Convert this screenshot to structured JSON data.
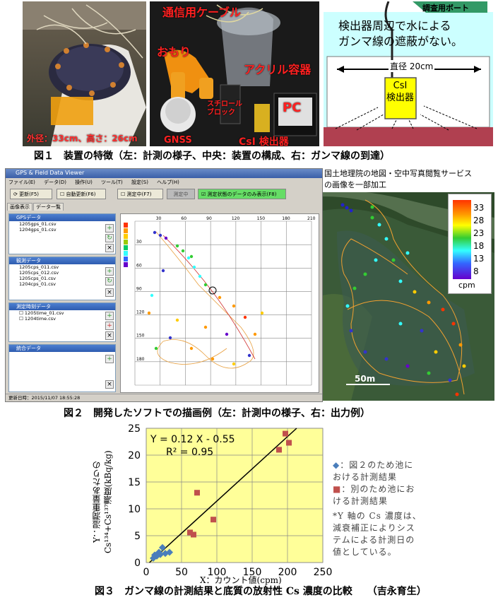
{
  "fig1": {
    "left_label": "外径：33cm、高さ：26cm",
    "center_labels": {
      "cable": "通信用ケーブル",
      "weight": "おもり",
      "acrylic": "アクリル容器",
      "styrofoam": "スチロール\nブロック",
      "pc": "PC",
      "gnss": "GNSS",
      "detector": "CsI 検出器"
    },
    "right": {
      "boat_label": "調査用ボート",
      "text": "検出器周辺で水による\nガンマ線の遮蔽がない。",
      "diameter": "直径 20cm",
      "csi": "CsI\n検出器"
    },
    "caption": "図１　装置の特徴（左：計測の様子、中央：装置の構成、右：ガンマ線の到達）"
  },
  "fig2": {
    "window_title": "GPS & Field Data Viewer",
    "menu": [
      "ファイル(E)",
      "データ(D)",
      "操作(U)",
      "ツール(T)",
      "設定(S)",
      "ヘルプ(H)"
    ],
    "toolbar": {
      "refresh": "更新(F5)",
      "auto_refresh": "自動更新(F6)",
      "measuring": "測定中(F7)",
      "measuring_btn": "測定中",
      "show_status": "測定状態のデータのみ表示(F8)"
    },
    "tabs": [
      "画像表示",
      "データ一覧"
    ],
    "panels": [
      {
        "title": "GPSデータ",
        "items": [
          "1205gps_01.csv",
          "1204gps_01.csv"
        ]
      },
      {
        "title": "観測データ",
        "items": [
          "1205cps_011.csv",
          "1205cps_012.csv",
          "1205cps_01.csv",
          "1204cps_01.csv"
        ]
      },
      {
        "title": "測定時刻データ",
        "items": [
          "1205time_01.csv",
          "1204time.csv"
        ]
      },
      {
        "title": "統合データ",
        "items": []
      }
    ],
    "status": "更新日時：2015/11/07 18:55:28",
    "plot_x_ticks": [
      "30",
      "60",
      "90",
      "120",
      "150",
      "180",
      "210"
    ],
    "plot_y_ticks": [
      "30",
      "60",
      "90",
      "120",
      "150",
      "180"
    ],
    "map_header": "国土地理院の地図・空中写真閲覧サービス\nの画像を一部加工",
    "legend": {
      "labels": [
        "33",
        "28",
        "23",
        "18",
        "13",
        "8"
      ],
      "unit": "cpm",
      "colors": [
        "#ff3300",
        "#ff9900",
        "#33cc33",
        "#00cc00",
        "#33ffff",
        "#0066ff",
        "#6600cc"
      ]
    },
    "scale": "50m",
    "caption": "図２　開発したソフトでの描画例（左：計測中の様子、右：出力例）"
  },
  "fig3": {
    "caption": "図３　ガンマ線の計測結果と底質の放射性 Cs 濃度の比較　　（吉永育生）",
    "notes": {
      "diamond": "◆：図２のため池に\nおける計測結果",
      "square": "■：別のため池にお\nける計測結果",
      "footnote": "*Y 軸の Cs 濃度は、\n減衰補正によりシス\nテムによる計測日の\n値としている。"
    }
  },
  "chart_data": {
    "type": "scatter",
    "xlabel": "X：カウント値(cpm)",
    "ylabel_line1": "Y：湿潤重量あたりの",
    "ylabel_line2": "Cs¹³⁴+Cs¹³⁷濃度(kBq/kg)",
    "xlim": [
      0,
      250
    ],
    "ylim": [
      0,
      25
    ],
    "x_ticks": [
      0,
      50,
      100,
      150,
      200,
      250
    ],
    "y_ticks": [
      0,
      5,
      10,
      15,
      20,
      25
    ],
    "grid": true,
    "equation": "Y = 0.12 X - 0.55",
    "r2": "R² = 0.95",
    "regression": {
      "slope": 0.12,
      "intercept": -0.55
    },
    "series": [
      {
        "marker": "diamond",
        "color": "#4a7ebb",
        "x": [
          10,
          12,
          15,
          18,
          20,
          23,
          27,
          33
        ],
        "y": [
          0.8,
          1.4,
          1.2,
          1.9,
          1.5,
          2.8,
          1.7,
          1.9
        ]
      },
      {
        "marker": "square",
        "color": "#c0504d",
        "x": [
          62,
          67,
          72,
          95,
          188,
          197,
          202
        ],
        "y": [
          5.6,
          5.2,
          13.0,
          8.0,
          21.0,
          24.0,
          22.3
        ]
      }
    ],
    "bg": "#ffff99"
  }
}
